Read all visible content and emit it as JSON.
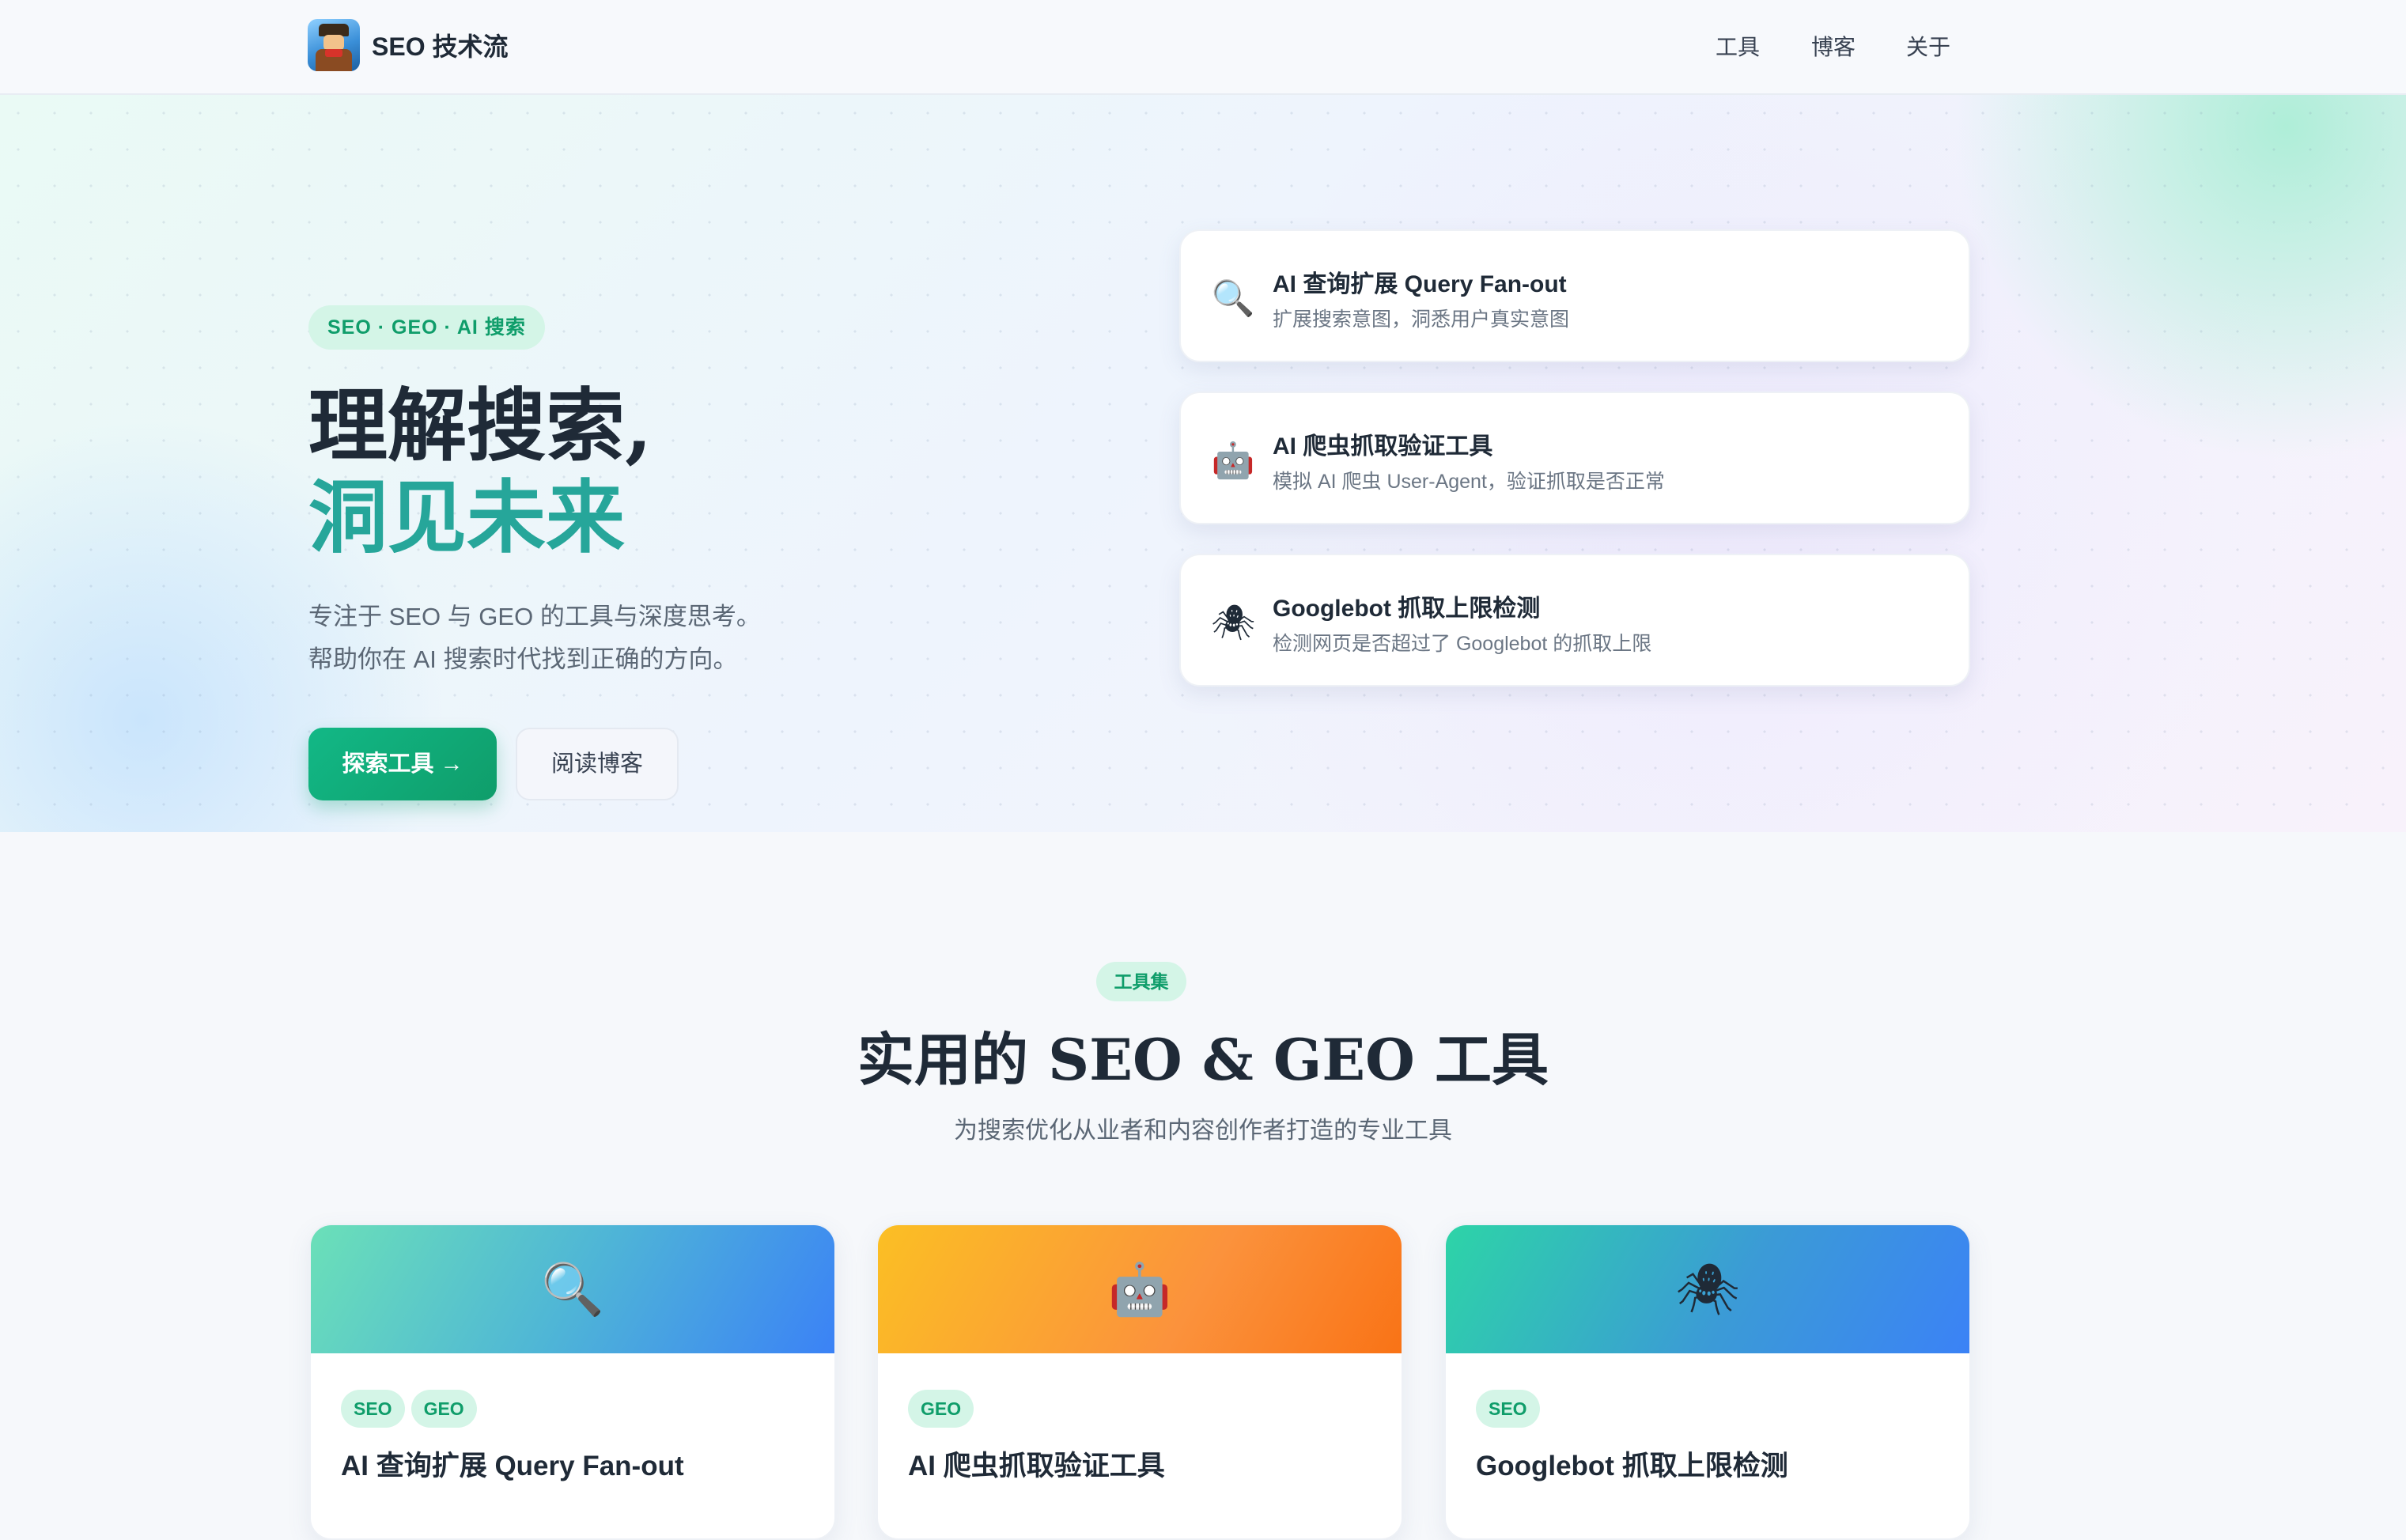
{
  "header": {
    "brand": "SEO 技术流",
    "nav": [
      "工具",
      "博客",
      "关于"
    ]
  },
  "hero": {
    "badge": "SEO · GEO · AI 搜索",
    "headline_line1": "理解搜索,",
    "headline_line2": "洞见未来",
    "subtitle_line1": "专注于 SEO 与 GEO 的工具与深度思考。",
    "subtitle_line2": "帮助你在 AI 搜索时代找到正确的方向。",
    "primary_button": "探索工具 →",
    "secondary_button": "阅读博客",
    "features": [
      {
        "icon": "magnifier-icon",
        "glyph": "🔍",
        "title": "AI 查询扩展 Query Fan-out",
        "desc": "扩展搜索意图，洞悉用户真实意图"
      },
      {
        "icon": "robot-icon",
        "glyph": "🤖",
        "title": "AI 爬虫抓取验证工具",
        "desc": "模拟 AI 爬虫 User-Agent，验证抓取是否正常"
      },
      {
        "icon": "spider-icon",
        "glyph": "🕷",
        "title": "Googlebot 抓取上限检测",
        "desc": "检测网页是否超过了 Googlebot 的抓取上限"
      }
    ]
  },
  "tools_section": {
    "badge": "工具集",
    "title": "实用的 SEO & GEO 工具",
    "subtitle": "为搜索优化从业者和内容创作者打造的专业工具",
    "cards": [
      {
        "icon": "magnifier-icon",
        "glyph": "🔍",
        "tags": [
          "SEO",
          "GEO"
        ],
        "title": "AI 查询扩展 Query Fan-out"
      },
      {
        "icon": "robot-icon",
        "glyph": "🤖",
        "tags": [
          "GEO"
        ],
        "title": "AI 爬虫抓取验证工具"
      },
      {
        "icon": "spider-icon",
        "glyph": "🕷",
        "tags": [
          "SEO"
        ],
        "title": "Googlebot 抓取上限检测"
      }
    ]
  },
  "colors": {
    "accent": "#0f9d6a",
    "headline_accent": "#26a69a",
    "badge_bg": "#d4f5e7"
  }
}
